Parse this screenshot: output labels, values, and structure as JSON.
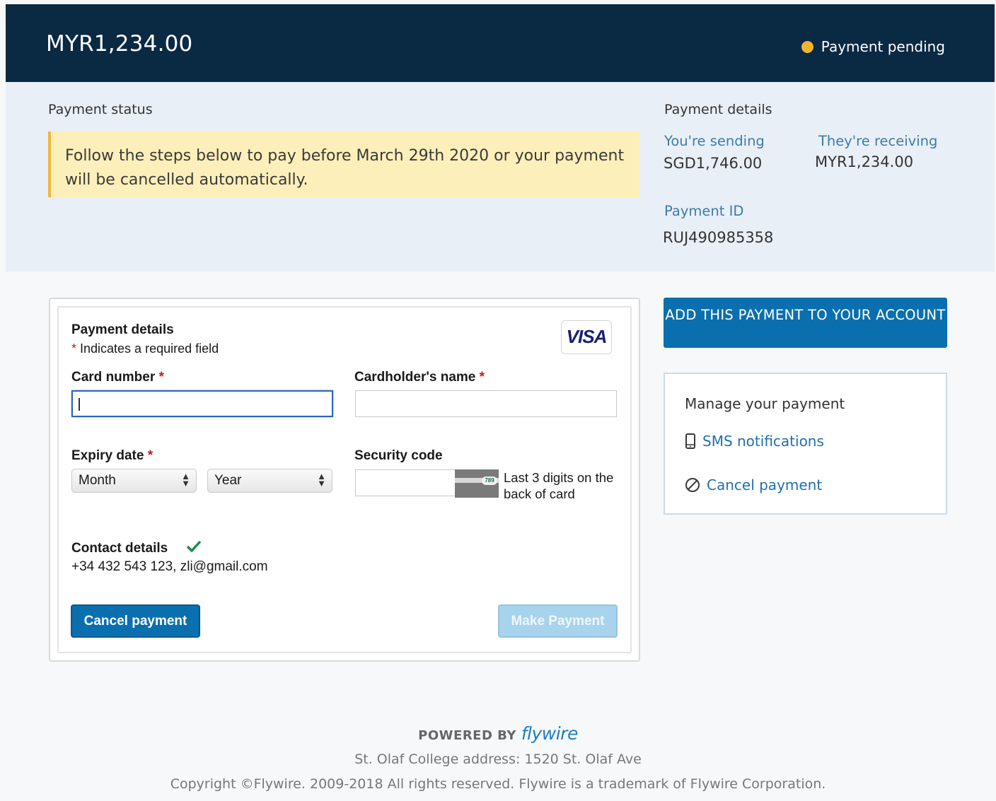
{
  "header": {
    "amount": "MYR1,234.00",
    "status_text": "Payment pending",
    "status_color": "#f1b52c"
  },
  "status_section": {
    "label": "Payment status",
    "notice": "Follow the steps below to pay before March 29th 2020 or your payment will be cancelled automatically."
  },
  "details_section": {
    "label": "Payment details",
    "sending_label": "You're sending",
    "sending_value": "SGD1,746.00",
    "receiving_label": "They're receiving",
    "receiving_value": "MYR1,234.00",
    "payment_id_label": "Payment ID",
    "payment_id_value": "RUJ490985358"
  },
  "form": {
    "title": "Payment details",
    "required_note_star": "*",
    "required_note": " Indicates a required field",
    "card_brand": "VISA",
    "card_number_label": "Card number",
    "card_number_value": "",
    "cardholder_label": "Cardholder's name",
    "cardholder_value": "",
    "expiry_label": "Expiry date",
    "month_selected": "Month",
    "year_selected": "Year",
    "security_label": "Security code",
    "security_value": "",
    "cvv_sample": "789",
    "security_hint": "Last 3 digits on the back of card",
    "contact_label": "Contact details",
    "contact_value": "+34 432 543 123, zli@gmail.com",
    "cancel_button": "Cancel payment",
    "make_button": "Make Payment"
  },
  "sidebar": {
    "add_button": "ADD THIS PAYMENT TO YOUR ACCOUNT",
    "manage_title": "Manage your payment",
    "sms_link": "SMS notifications",
    "cancel_link": "Cancel payment"
  },
  "footer": {
    "powered_by": "POWERED BY",
    "brand": "flywire",
    "address": "St. Olaf College address: 1520 St. Olaf Ave",
    "copyright": "Copyright ©Flywire. 2009-2018 All rights reserved. Flywire is a trademark of Flywire Corporation."
  },
  "colors": {
    "header_bg": "#0a2942",
    "primary_button": "#0a6fae",
    "link": "#1f6fb0",
    "notice_bg": "#fdefb9",
    "success_check": "#1f8a4c"
  }
}
